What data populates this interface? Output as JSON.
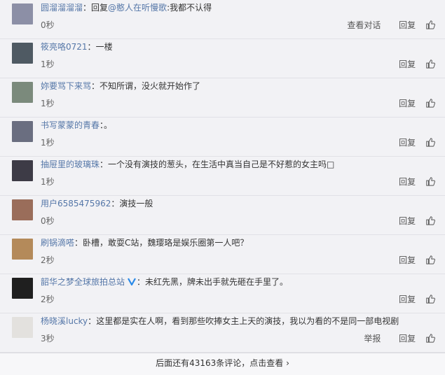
{
  "comments": [
    {
      "user": "圆溜溜溜溜",
      "colon": "：",
      "text_prefix": "回复",
      "mention": "@憨人在听慢歌",
      "text": ":我都不认得",
      "time": "0秒",
      "actions": [
        "查看对话",
        "回复"
      ],
      "avatar_color": "#8c8fa6"
    },
    {
      "user": "筱亮咯0721",
      "colon": "：",
      "text": "一楼",
      "time": "1秒",
      "actions": [
        "回复"
      ],
      "avatar_color": "#4f5a63"
    },
    {
      "user": "妳要骂下来骂",
      "colon": "：",
      "text": "不知所谓，没火就开始作了",
      "time": "1秒",
      "actions": [
        "回复"
      ],
      "avatar_color": "#7b8a7c"
    },
    {
      "user": "书写蒙蒙的青春",
      "colon": "：",
      "text": "。",
      "time": "1秒",
      "actions": [
        "回复"
      ],
      "avatar_color": "#6a6e80"
    },
    {
      "user": "抽屉里的玻璃珠",
      "colon": "：",
      "text": "一个没有演技的葱头，在生活中真当自己是不好惹的女主吗□",
      "time": "1秒",
      "actions": [
        "回复"
      ],
      "avatar_color": "#3d3b46"
    },
    {
      "user": "用户6585475962",
      "colon": "：",
      "text": "演技一般",
      "time": "0秒",
      "actions": [
        "回复"
      ],
      "avatar_color": "#9a6d5a"
    },
    {
      "user": "刷锅滴嗒",
      "colon": "：",
      "text": "卧槽，敢耍C站，魏璎珞是娱乐圈第一人吧？",
      "time": "2秒",
      "actions": [
        "回复"
      ],
      "avatar_color": "#b48a5a"
    },
    {
      "user": "韶华之梦全球旅拍总站",
      "colon": "：",
      "verified": true,
      "text": "未红先黑，牌未出手就先砸在手里了。",
      "time": "2秒",
      "actions": [
        "回复"
      ],
      "avatar_color": "#1f1f1f"
    },
    {
      "user": "杨晓溪lucky",
      "colon": "：",
      "text": "这里都是实在人啊，看到那些吹捧女主上天的演技，我以为看的不是同一部电视剧",
      "time": "3秒",
      "actions": [
        "举报",
        "回复"
      ],
      "avatar_color": "#e3e1de"
    }
  ],
  "more": {
    "label": "后面还有43163条评论，点击查看",
    "arrow": "›"
  },
  "icons": {
    "like": "thumbs-up-icon",
    "verified": "verified-v-icon"
  },
  "colors": {
    "link": "#5577a8",
    "background": "#f2f2f5",
    "verified": "#2a8ae8"
  }
}
